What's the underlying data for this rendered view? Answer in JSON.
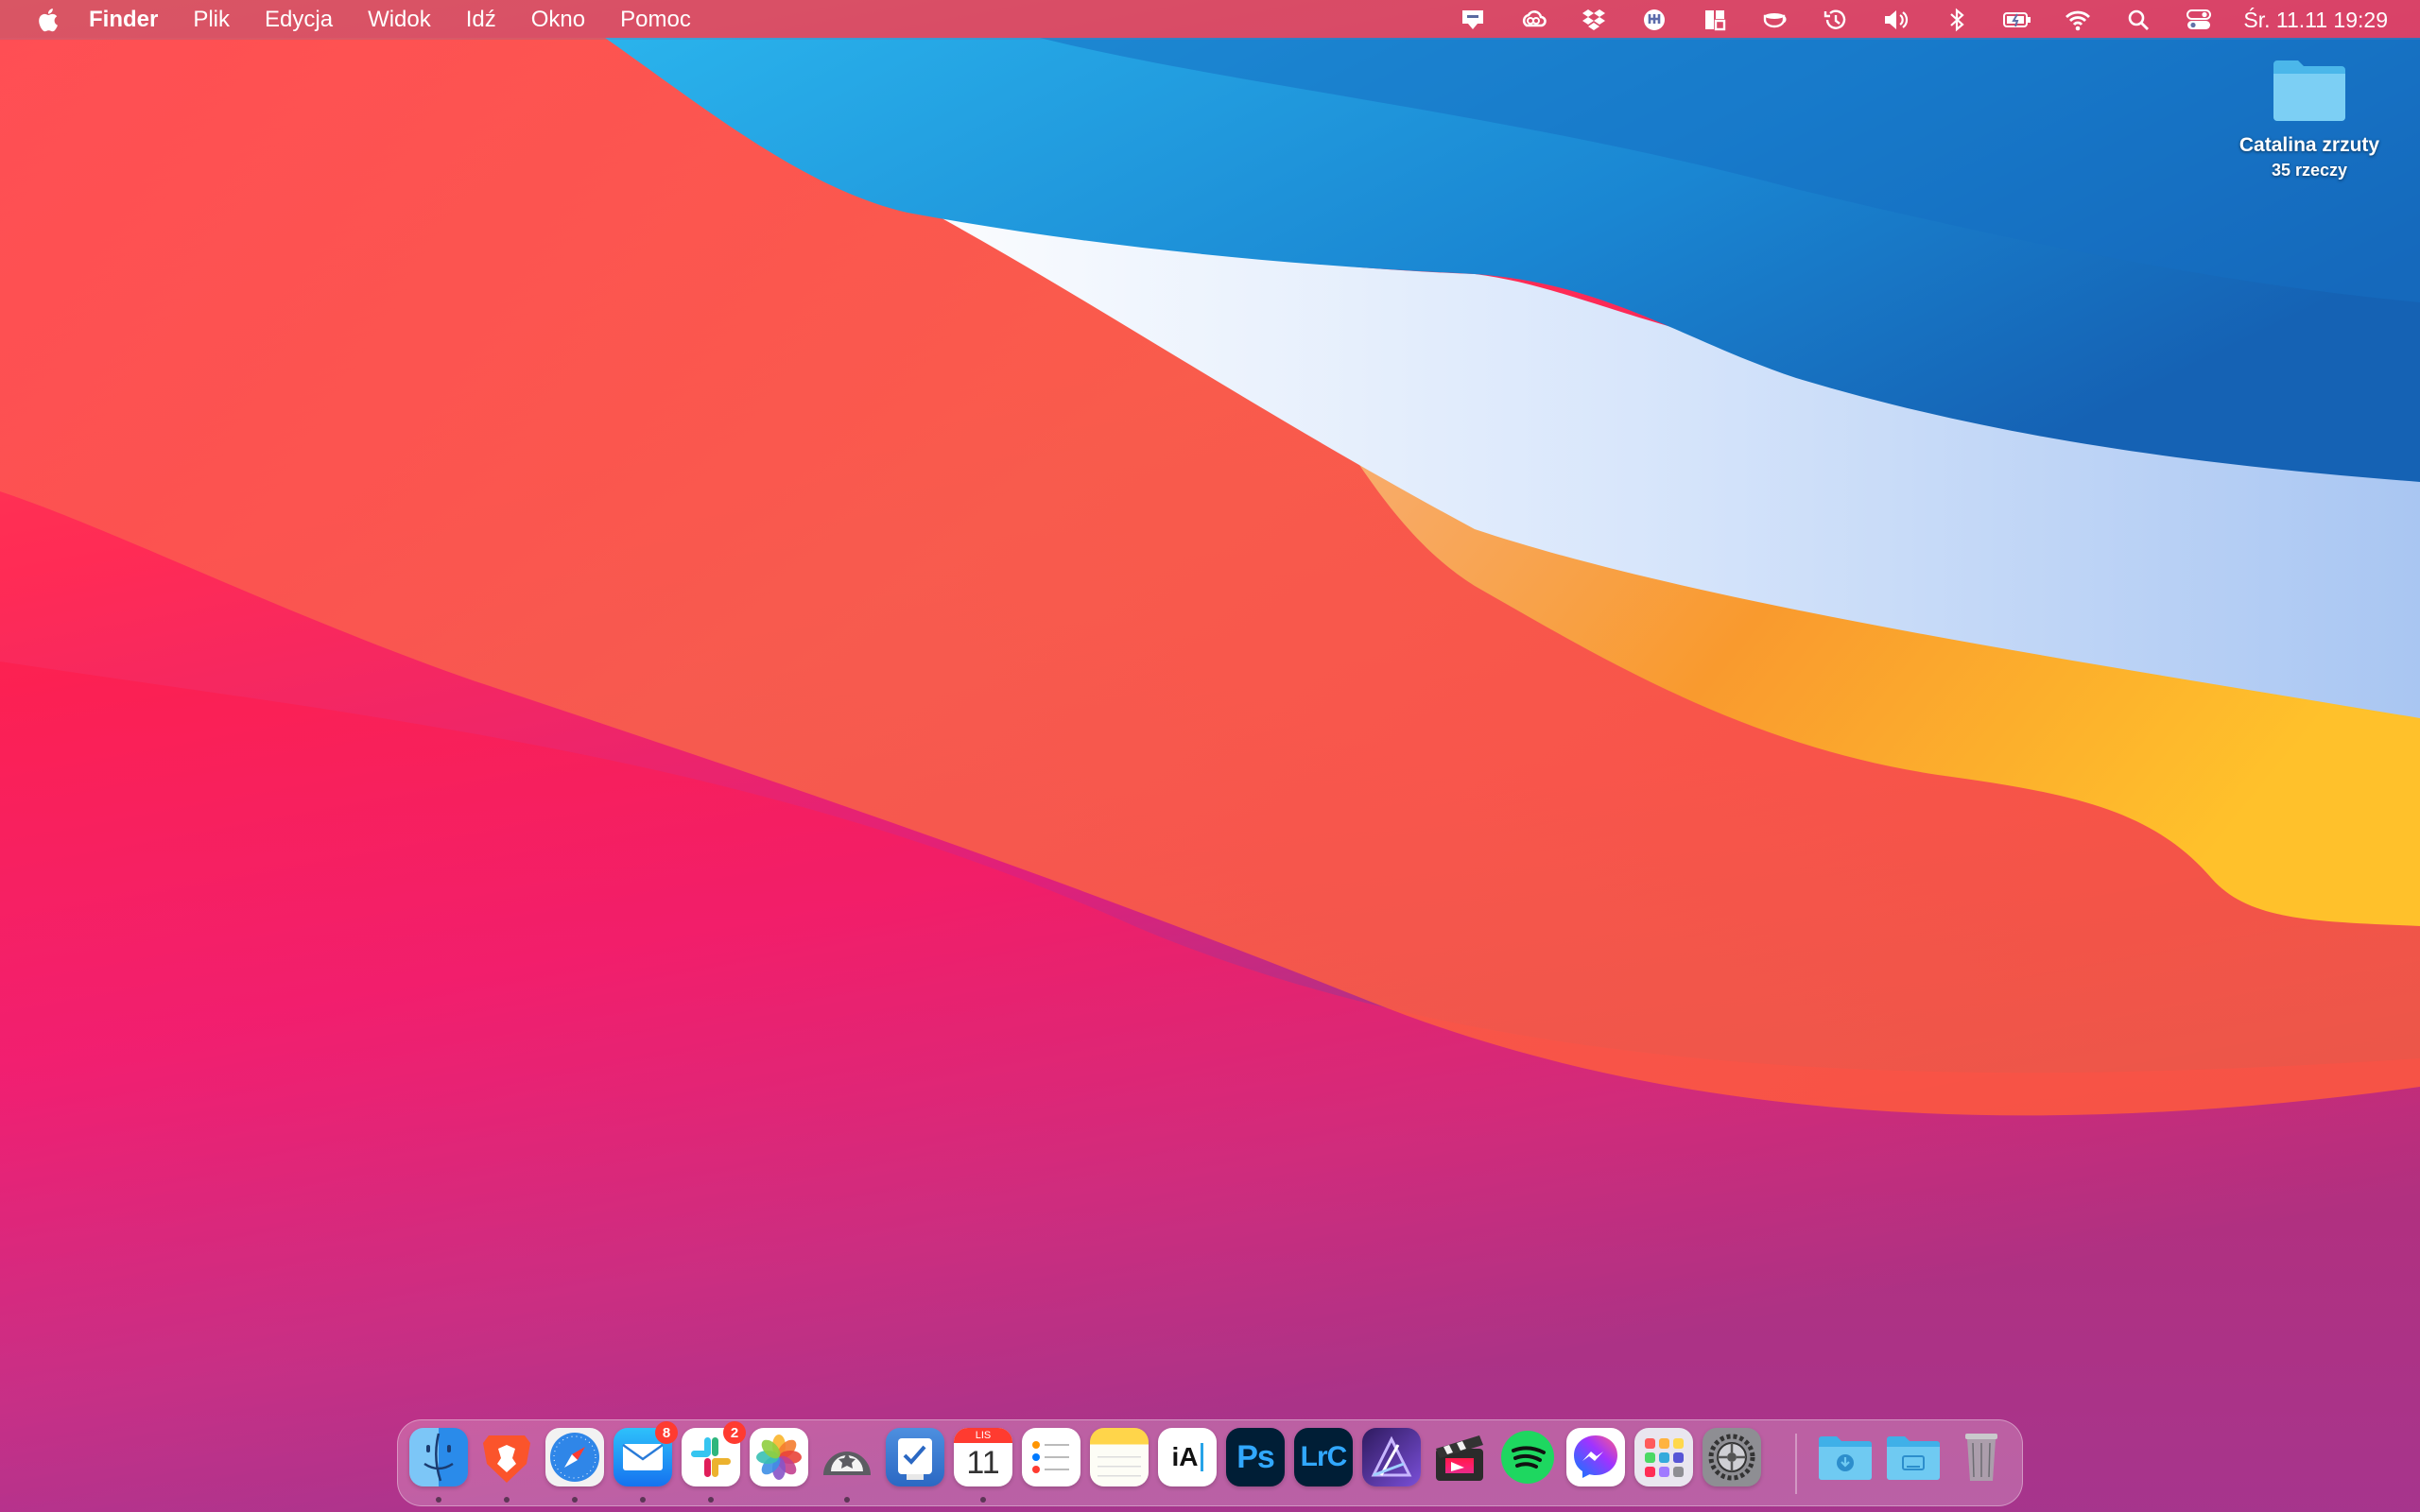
{
  "menubar": {
    "apple_icon": "apple-logo",
    "app_name": "Finder",
    "items": [
      "Plik",
      "Edycja",
      "Widok",
      "Idź",
      "Okno",
      "Pomoc"
    ],
    "status_icons": [
      "notification-icon",
      "creative-cloud-icon",
      "dropbox-icon",
      "bitwarden-icon",
      "magnet-icon",
      "amphetamine-icon",
      "time-machine-icon",
      "volume-icon",
      "bluetooth-icon",
      "battery-icon",
      "wifi-icon",
      "spotlight-icon",
      "control-center-icon"
    ],
    "clock": "Śr. 11.11  19:29"
  },
  "desktop": {
    "folder": {
      "name": "Catalina zrzuty",
      "count": "35 rzeczy"
    }
  },
  "dock": {
    "apps": [
      {
        "name": "Finder",
        "icon": "finder-icon",
        "running": true
      },
      {
        "name": "Brave",
        "icon": "brave-icon",
        "running": true
      },
      {
        "name": "Safari",
        "icon": "safari-icon",
        "running": true
      },
      {
        "name": "Mail",
        "icon": "mail-icon",
        "running": true,
        "badge": "8"
      },
      {
        "name": "Slack",
        "icon": "slack-icon",
        "running": true,
        "badge": "2"
      },
      {
        "name": "Zdjęcia",
        "icon": "photos-icon",
        "running": false
      },
      {
        "name": "Reeder",
        "icon": "reeder-icon",
        "running": true
      },
      {
        "name": "Things",
        "icon": "things-icon",
        "running": false
      },
      {
        "name": "Kalendarz",
        "icon": "calendar-icon",
        "running": true,
        "month": "LIS",
        "day": "11"
      },
      {
        "name": "Przypomnienia",
        "icon": "reminders-icon",
        "running": false
      },
      {
        "name": "Notatki",
        "icon": "notes-icon",
        "running": false
      },
      {
        "name": "iA Writer",
        "icon": "ia-writer-icon",
        "running": false,
        "label": "iA"
      },
      {
        "name": "Photoshop",
        "icon": "photoshop-icon",
        "running": false,
        "label": "Ps"
      },
      {
        "name": "Lightroom Classic",
        "icon": "lightroom-icon",
        "running": false,
        "label": "LrC"
      },
      {
        "name": "Affinity Designer",
        "icon": "affinity-icon",
        "running": false
      },
      {
        "name": "Final Cut Pro",
        "icon": "final-cut-icon",
        "running": false
      },
      {
        "name": "Spotify",
        "icon": "spotify-icon",
        "running": false
      },
      {
        "name": "Messenger",
        "icon": "messenger-icon",
        "running": false
      },
      {
        "name": "Launchpad",
        "icon": "launchpad-icon",
        "running": false
      },
      {
        "name": "Preferencje systemowe",
        "icon": "settings-icon",
        "running": false
      }
    ],
    "stacks": [
      {
        "name": "Pobrane",
        "icon": "downloads-folder-icon"
      },
      {
        "name": "Dokumenty",
        "icon": "documents-folder-icon"
      },
      {
        "name": "Kosz",
        "icon": "trash-icon"
      }
    ]
  },
  "colors": {
    "sky_blue": "#1e9be0",
    "deep_blue": "#1772c4",
    "light_band": "#dbe8f8",
    "orange": "#f9a23a",
    "coral": "#f4583f",
    "red": "#ff1f4c",
    "magenta": "#d4206e",
    "purple": "#5b3f8c"
  }
}
